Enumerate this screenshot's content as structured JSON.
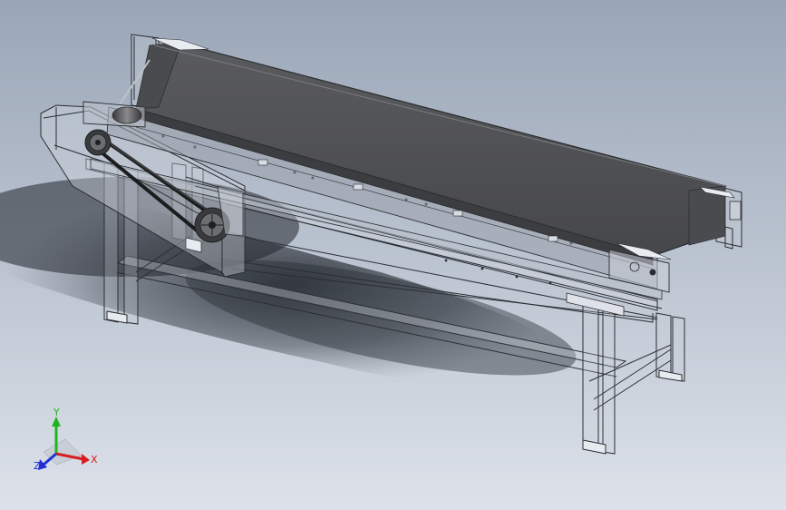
{
  "view": {
    "background_top": "#9aa6b7",
    "background_bottom": "#dde2ea",
    "model": "belt-conveyor-assembly",
    "render_mode": "shaded-with-transparent-frame"
  },
  "colors": {
    "belt": "#4e4f52",
    "belt_edge": "#2c2d30",
    "frame_lines": "#2b2e33",
    "shadow": "#2a2e35"
  },
  "triad": {
    "x_label": "X",
    "y_label": "Y",
    "z_label": "Z",
    "x_color": "#d61e1e",
    "y_color": "#1fb51f",
    "z_color": "#2030d8"
  }
}
